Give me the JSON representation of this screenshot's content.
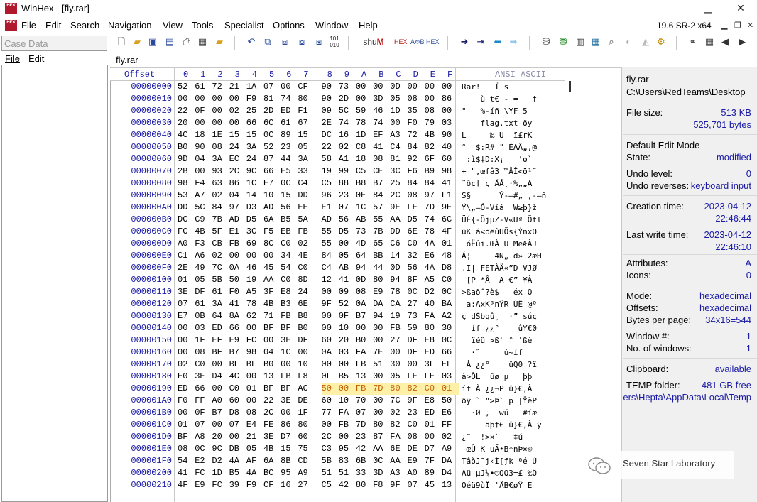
{
  "window": {
    "title": "WinHex - [fly.rar]",
    "app_icon_text": "HEX"
  },
  "menu": [
    "File",
    "Edit",
    "Search",
    "Navigation",
    "View",
    "Tools",
    "Specialist",
    "Options",
    "Window",
    "Help"
  ],
  "version": "19.6 SR-2 x64",
  "case_panel": {
    "title": "Case Data",
    "menu": [
      "File",
      "Edit"
    ]
  },
  "tab": "fly.rar",
  "hex": {
    "offset_header": "Offset",
    "columns": [
      "0",
      "1",
      "2",
      "3",
      "4",
      "5",
      "6",
      "7",
      "8",
      "9",
      "A",
      "B",
      "C",
      "D",
      "E",
      "F"
    ],
    "ansi_header": "ANSI ASCII",
    "offsets": [
      "00000000",
      "00000010",
      "00000020",
      "00000030",
      "00000040",
      "00000050",
      "00000060",
      "00000070",
      "00000080",
      "00000090",
      "000000A0",
      "000000B0",
      "000000C0",
      "000000D0",
      "000000E0",
      "000000F0",
      "00000100",
      "00000110",
      "00000120",
      "00000130",
      "00000140",
      "00000150",
      "00000160",
      "00000170",
      "00000180",
      "00000190",
      "000001A0",
      "000001B0",
      "000001C0",
      "000001D0",
      "000001E0",
      "000001F0",
      "00000200",
      "00000210"
    ],
    "rows": [
      "52 61 72 21 1A 07 00 CF 90 73 00 00 0D 00 00 00",
      "00 00 00 00 F9 81 74 80 90 2D 00 3D 05 08 00 86",
      "22 0F 00 02 25 2D ED F1 09 5C 59 46 1D 35 08 00",
      "20 00 00 00 66 6C 61 67 2E 74 78 74 00 F0 79 03",
      "4C 18 1E 15 15 0C 89 15 DC 16 1D EF A3 72 4B 90",
      "B0 90 08 24 3A 52 23 05 22 02 C8 41 C4 84 82 40",
      "9D 04 3A EC 24 87 44 3A 58 A1 18 08 81 92 6F 60",
      "2B 00 93 2C 9C 66 E5 33 19 99 C5 CE 3C F6 B9 98",
      "98 F4 63 86 1C E7 0C C4 C5 88 B8 B7 25 84 84 41",
      "53 A7 02 04 14 10 15 DD 96 23 0E 84 2C 08 97 F1",
      "DD 5C 84 97 D3 AD 56 EE E1 07 1C 57 9E FE 7D 9E",
      "DC C9 7B AD D5 6A B5 5A AD 56 AB 55 AA D5 74 6C",
      "FC 4B 5F E1 3C F5 EB FB 55 D5 73 7B DD 6E 78 4F",
      "A0 F3 CB FB 69 8C C0 02 55 00 4D 65 C6 C0 4A 01",
      "C1 A6 02 00 00 00 34 4E 84 05 64 BB 14 32 E6 48",
      "2E 49 7C 0A 46 45 54 C0 C4 AB 94 44 0D 56 4A D8",
      "01 05 5B 50 19 AA C0 8D 12 41 0D 80 94 8F A5 C0",
      "3E DF 61 F0 A5 3F E8 24 00 09 08 E9 78 0C D2 0C",
      "07 61 3A 41 78 4B B3 6E 9F 52 0A DA CA 27 40 BA",
      "E7 0B 64 8A 62 71 FB B8 00 0F B7 94 19 73 FA A2",
      "00 03 ED 66 00 BF BF B0 00 10 00 00 FB 59 80 30",
      "00 1F EF E9 FC 00 3E DF 60 20 B0 00 27 DF E8 0C",
      "00 08 BF B7 98 04 1C 00 0A 03 FA 7E 00 DF ED 66",
      "02 C0 00 BF BF B0 00 10 00 00 FB 51 30 00 3F EF",
      "E0 3E D4 4C 00 13 FB F8 0F B5 13 00 05 FE FE 03",
      "ED 66 00 C0 01 BF BF AC 50 00 FB 7D 80 82 C0 01",
      "F0 FF A0 60 00 22 3E DE 60 10 70 00 7C 9F E8 50",
      "00 0F B7 D8 08 2C 00 1F 77 FA 07 00 02 23 ED E6",
      "01 07 00 07 E4 FE 86 80 00 FB 7D 80 82 C0 01 FF",
      "BF A8 20 00 21 3E D7 60 2C 00 23 87 FA 08 00 02",
      "08 0C 9C DB 05 4B 15 75 C3 95 42 AA 6E DE D7 A9",
      "54 E2 D2 4A AF 6A 8B CD 5B 83 6B 0C AA E9 7F DA",
      "41 FC 1D B5 4A BC 95 A9 51 51 33 3D A3 A0 89 D4",
      "4F E9 FC 39 F9 CF 16 27 C5 42 80 F8 9F 07 45 13"
    ],
    "ansi": [
      "Rar!   Ï s",
      "    ù t€ - =   †",
      "\"   %-íñ \\YF 5",
      "    flag.txt ðy",
      "L     ‰ Ü  ï£rK",
      "°  $:R# \" ÈAÄ„‚@",
      " :ì$‡D:X¡   ’o`",
      "+ \",œfå3 ™ÅÎ<ö¹˜",
      "˜ôc† ç ÄÅ¸·%„„A",
      "S§      Ý-–#„ ,-—ñ",
      "Ý\\„—Ó-Víá  W≥þ}ž",
      "ÜÉ{-ÕjµZ-V«Uª Õtl",
      "üK_á<õëûUÕs{ÝnxO",
      " óËûi.ŒÀ U MeÆÀJ",
      "Á¦     4N„ d» 2æH",
      ".I| FETÀÄ«”D VJØ",
      " [P *Â  A €” ¥À",
      ">ßaðˆ?è$   éx Ò",
      " a:AxK³nŸR ÚÊ'@º",
      "ç dŠbqû¸  ·” súç",
      "  íf ¿¿°    ûY€0",
      "  ïéü >ß` ° 'ßè",
      "  ·˜     ú~íf",
      " À ¿¿°    ûQ0 ?ï",
      "à>ÔL  ûø µ   þþ",
      "íf À ¿¿¬P û}€‚À",
      "ðÿ ` \">Þ` p |ŸèP",
      "  ·Ø ,  wú   #íæ",
      "     äþ†€ û}€‚À ÿ",
      "¿¨  !>×`   ‡ú",
      " œÛ K uÃ•B*nÞ×©",
      "TâòJ¯j‹Í[ƒk ªé Ú",
      "Aü µJ¼•©QQ3=£ ‰Ô",
      "Oéü9ùÏ 'ÅB€øŸ E"
    ],
    "selected_row": 25,
    "selected_from_col": 8
  },
  "info": {
    "file_name": "fly.rar",
    "file_path": "C:\\Users\\RedTeams\\Desktop",
    "file_size_label": "File size:",
    "file_size_kb": "513 KB",
    "file_size_bytes": "525,701 bytes",
    "edit_mode_label": "Default Edit Mode",
    "state_label": "State:",
    "state_value": "modified",
    "undo_level_label": "Undo level:",
    "undo_level_value": "0",
    "undo_rev_label": "Undo reverses:",
    "undo_rev_value": "keyboard input",
    "creation_label": "Creation time:",
    "creation_date": "2023-04-12",
    "creation_time": "22:46:44",
    "lastwrite_label": "Last write time:",
    "lastwrite_date": "2023-04-12",
    "lastwrite_time": "22:46:10",
    "attributes_label": "Attributes:",
    "attributes_value": "A",
    "icons_label": "Icons:",
    "icons_value": "0",
    "mode_label": "Mode:",
    "mode_value": "hexadecimal",
    "offsets_label": "Offsets:",
    "offsets_value": "hexadecimal",
    "bpp_label": "Bytes per page:",
    "bpp_value": "34x16=544",
    "window_no_label": "Window #:",
    "window_no_value": "1",
    "no_windows_label": "No. of windows:",
    "no_windows_value": "1",
    "clipboard_label": "Clipboard:",
    "clipboard_value": "available",
    "temp_label": "TEMP folder:",
    "temp_value": "481 GB free",
    "temp_path": "ers\\Hepta\\AppData\\Local\\Temp"
  },
  "watermark": "Seven Star Laboratory",
  "colors": {
    "accent_blue": "#1a1aa6",
    "selection": "#fff0a8",
    "panel_bg": "#f0f0f0"
  }
}
